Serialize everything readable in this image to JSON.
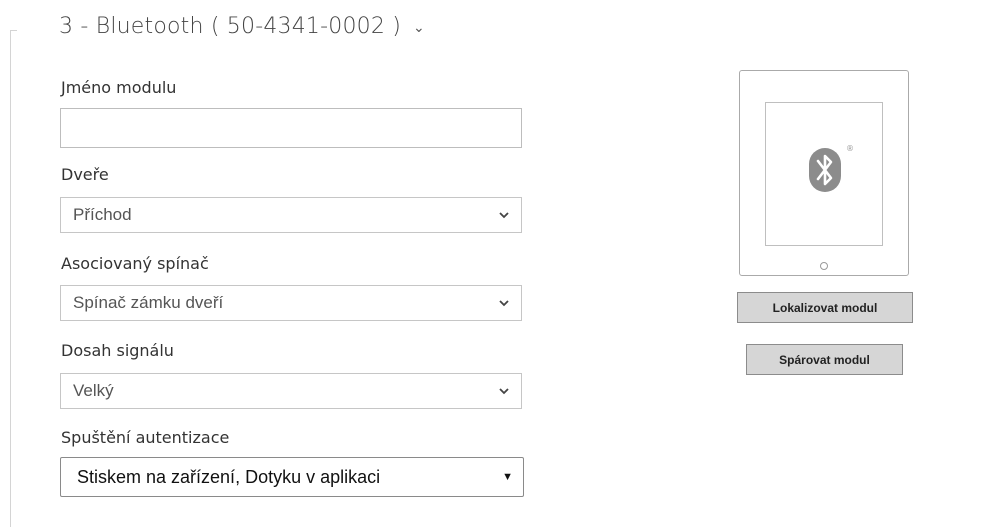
{
  "section": {
    "title": "3 - Bluetooth ( 50-4341-0002 )",
    "chevron_icon": "chevron-down-icon"
  },
  "form": {
    "module_name": {
      "label": "Jméno modulu",
      "value": ""
    },
    "door": {
      "label": "Dveře",
      "value": "Příchod"
    },
    "switch": {
      "label": "Asociovaný spínač",
      "value": "Spínač zámku dveří"
    },
    "range": {
      "label": "Dosah signálu",
      "value": "Velký"
    },
    "auth": {
      "label": "Spuštění autentizace",
      "value": "Stiskem na zařízení, Dotyku v aplikaci"
    }
  },
  "device": {
    "icon": "bluetooth-icon",
    "registered_mark": "®"
  },
  "actions": {
    "locate_label": "Lokalizovat modul",
    "pair_label": "Spárovat modul"
  }
}
